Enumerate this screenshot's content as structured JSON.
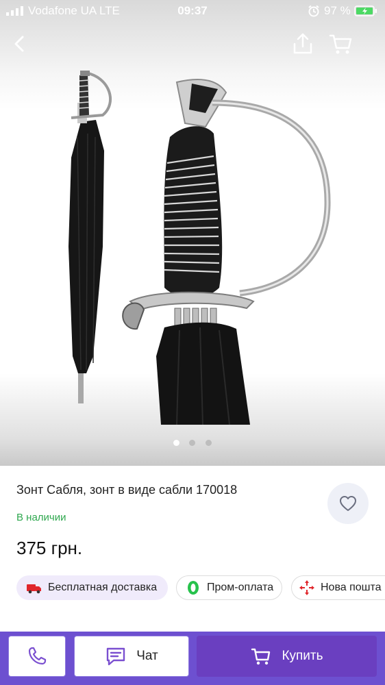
{
  "status_bar": {
    "carrier": "Vodafone UA  LTE",
    "time": "09:37",
    "battery": "97 %"
  },
  "nav": {
    "back_icon": "chevron-left-icon",
    "share_icon": "share-icon",
    "cart_icon": "cart-icon"
  },
  "carousel": {
    "total": 3,
    "active": 1
  },
  "product": {
    "title": "Зонт Сабля, зонт в виде сабли 170018",
    "availability": "В наличии",
    "price": "375 грн."
  },
  "chips": {
    "delivery": "Бесплатная доставка",
    "prom": "Пром-оплата",
    "nova": "Нова пошта"
  },
  "actions": {
    "chat": "Чат",
    "buy": "Купить"
  },
  "colors": {
    "accent": "#6a3fc0",
    "bottom_bar": "#6d50d0",
    "in_stock": "#2fa84f",
    "delivery_chip": "#f0ebfb",
    "nova_red": "#e0262b",
    "prom_green": "#27c24c"
  }
}
